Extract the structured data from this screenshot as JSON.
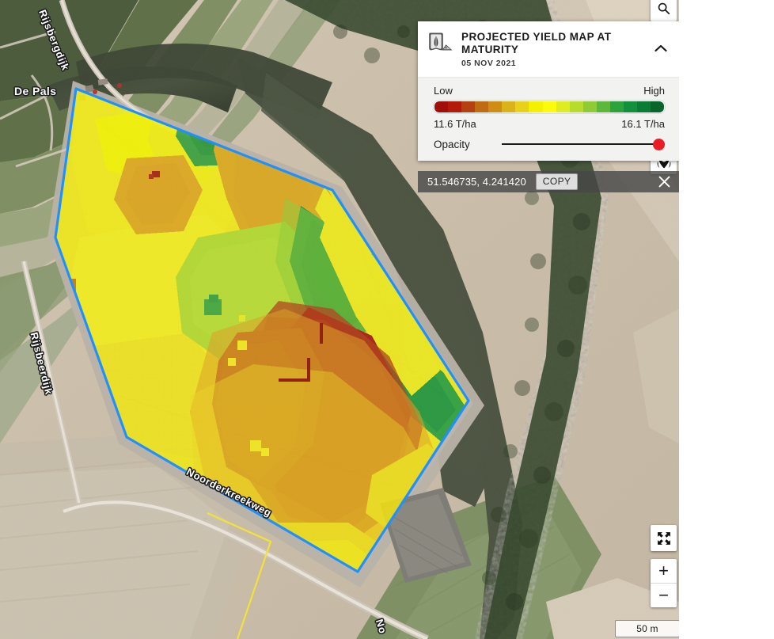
{
  "panel": {
    "icon": "crop-yield-icon",
    "title": "PROJECTED YIELD MAP AT MATURITY",
    "date": "05 NOV 2021",
    "collapse_icon": "chevron-up-icon",
    "legend": {
      "low_label": "Low",
      "high_label": "High",
      "min_value": "11.6 T/ha",
      "max_value": "16.1 T/ha",
      "colors": [
        "#a01008",
        "#b41a0a",
        "#b4410f",
        "#c06a12",
        "#cf8d14",
        "#dcb219",
        "#e8d11b",
        "#f5f000",
        "#fbfb0a",
        "#e0ec22",
        "#b7dc2c",
        "#8ecb34",
        "#5cb83a",
        "#2da33c",
        "#12913a",
        "#0b7c33",
        "#09662b"
      ]
    },
    "opacity": {
      "label": "Opacity",
      "value": 100
    }
  },
  "coordinate_bar": {
    "coordinates": "51.546735, 4.241420",
    "copy_label": "COPY",
    "close_icon": "close-icon"
  },
  "map_controls": {
    "search_icon": "search-icon",
    "locate_icon": "location-pin-icon",
    "fit_icon": "fit-to-screen-icon",
    "zoom_in_label": "+",
    "zoom_out_label": "−"
  },
  "scale": {
    "label": "50 m"
  },
  "map_labels": [
    {
      "name": "road-label-rijsbergdijk-north",
      "text": "Rijsbergdijk"
    },
    {
      "name": "place-label-de-pals",
      "text": "De Pals"
    },
    {
      "name": "road-label-rijsbeerdijk-west",
      "text": "Rijsbeerdijk"
    },
    {
      "name": "road-label-noorderkreekweg",
      "text": "Noorderkreekweg"
    },
    {
      "name": "road-label-noorderkreekweg-bottom",
      "text": "No"
    }
  ],
  "chart_data": {
    "type": "heatmap",
    "title": "PROJECTED YIELD MAP AT MATURITY",
    "subtitle": "05 NOV 2021",
    "unit": "T/ha",
    "vmin": 11.6,
    "vmax": 16.1,
    "legend_position": "top-right",
    "low_label": "Low",
    "high_label": "High",
    "colormap": [
      "#a01008",
      "#b41a0a",
      "#b4410f",
      "#c06a12",
      "#cf8d14",
      "#dcb219",
      "#e8d11b",
      "#f5f000",
      "#fbfb0a",
      "#e0ec22",
      "#b7dc2c",
      "#8ecb34",
      "#5cb83a",
      "#2da103",
      "#12913a",
      "#0b7c33",
      "#09662b"
    ],
    "center_coordinates": "51.546735, 4.241420",
    "scale_bar": "50 m",
    "description": "Pixelated raster yield map over a single agricultural field parcel. Highest projected yields (green, ~15-16.1 T/ha) occur along the north-east interior; lowest projected yields (dark red, ~11.6-12.5 T/ha) dominate the south-east lobe of the field. Mid-range yellows (~13.5-14.5 T/ha) fill the western half."
  }
}
